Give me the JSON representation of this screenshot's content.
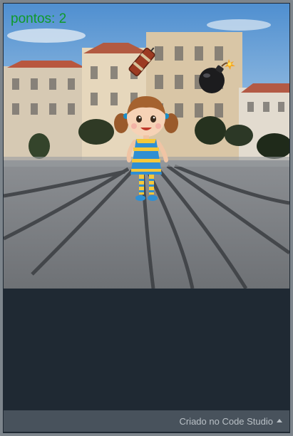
{
  "game": {
    "score_text": "pontos: 2",
    "colors": {
      "score": "#0f9a2a",
      "stage_bg": "#1f2933",
      "footer_bg": "#48525c"
    },
    "sprites": [
      "girl-character",
      "dynamite-stick",
      "bomb"
    ]
  },
  "footer": {
    "credit_label": "Criado no Code Studio",
    "credit_icon": "caret-up-icon"
  }
}
